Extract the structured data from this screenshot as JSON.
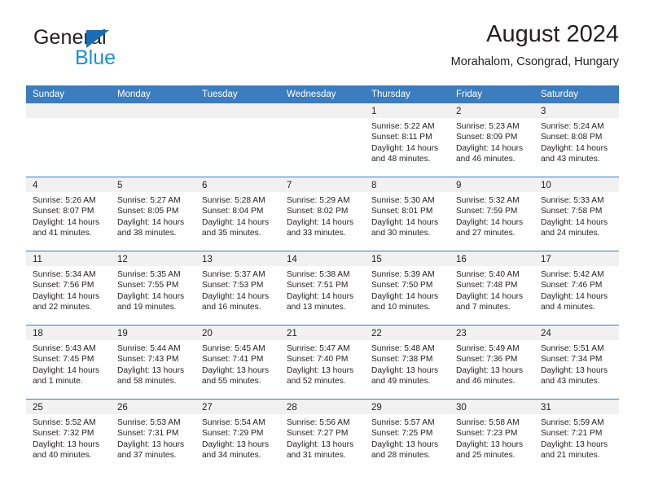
{
  "brand": {
    "word_one": "General",
    "word_two": "Blue",
    "triangle_icon": "triangle-icon",
    "colors": {
      "dark": "#231f20",
      "blue": "#1a8fd8",
      "triangle": "#1a6cb5"
    }
  },
  "header": {
    "title": "August 2024",
    "subtitle": "Morahalom, Csongrad, Hungary"
  },
  "theme": {
    "header_bar": "#3b7dbf",
    "day_number_band": "#f1f1f1",
    "text": "#231f20",
    "cell_background": "#ffffff"
  },
  "weekday_headers": [
    "Sunday",
    "Monday",
    "Tuesday",
    "Wednesday",
    "Thursday",
    "Friday",
    "Saturday"
  ],
  "labels": {
    "sunrise_prefix": "Sunrise:",
    "sunset_prefix": "Sunset:",
    "daylight_prefix": "Daylight:"
  },
  "weeks": [
    [
      {
        "day": "",
        "empty": true,
        "sunrise": "",
        "sunset": "",
        "daylight_line1": "",
        "daylight_line2": ""
      },
      {
        "day": "",
        "empty": true,
        "sunrise": "",
        "sunset": "",
        "daylight_line1": "",
        "daylight_line2": ""
      },
      {
        "day": "",
        "empty": true,
        "sunrise": "",
        "sunset": "",
        "daylight_line1": "",
        "daylight_line2": ""
      },
      {
        "day": "",
        "empty": true,
        "sunrise": "",
        "sunset": "",
        "daylight_line1": "",
        "daylight_line2": ""
      },
      {
        "day": "1",
        "empty": false,
        "sunrise": "Sunrise: 5:22 AM",
        "sunset": "Sunset: 8:11 PM",
        "daylight_line1": "Daylight: 14 hours",
        "daylight_line2": "and 48 minutes."
      },
      {
        "day": "2",
        "empty": false,
        "sunrise": "Sunrise: 5:23 AM",
        "sunset": "Sunset: 8:09 PM",
        "daylight_line1": "Daylight: 14 hours",
        "daylight_line2": "and 46 minutes."
      },
      {
        "day": "3",
        "empty": false,
        "sunrise": "Sunrise: 5:24 AM",
        "sunset": "Sunset: 8:08 PM",
        "daylight_line1": "Daylight: 14 hours",
        "daylight_line2": "and 43 minutes."
      }
    ],
    [
      {
        "day": "4",
        "empty": false,
        "sunrise": "Sunrise: 5:26 AM",
        "sunset": "Sunset: 8:07 PM",
        "daylight_line1": "Daylight: 14 hours",
        "daylight_line2": "and 41 minutes."
      },
      {
        "day": "5",
        "empty": false,
        "sunrise": "Sunrise: 5:27 AM",
        "sunset": "Sunset: 8:05 PM",
        "daylight_line1": "Daylight: 14 hours",
        "daylight_line2": "and 38 minutes."
      },
      {
        "day": "6",
        "empty": false,
        "sunrise": "Sunrise: 5:28 AM",
        "sunset": "Sunset: 8:04 PM",
        "daylight_line1": "Daylight: 14 hours",
        "daylight_line2": "and 35 minutes."
      },
      {
        "day": "7",
        "empty": false,
        "sunrise": "Sunrise: 5:29 AM",
        "sunset": "Sunset: 8:02 PM",
        "daylight_line1": "Daylight: 14 hours",
        "daylight_line2": "and 33 minutes."
      },
      {
        "day": "8",
        "empty": false,
        "sunrise": "Sunrise: 5:30 AM",
        "sunset": "Sunset: 8:01 PM",
        "daylight_line1": "Daylight: 14 hours",
        "daylight_line2": "and 30 minutes."
      },
      {
        "day": "9",
        "empty": false,
        "sunrise": "Sunrise: 5:32 AM",
        "sunset": "Sunset: 7:59 PM",
        "daylight_line1": "Daylight: 14 hours",
        "daylight_line2": "and 27 minutes."
      },
      {
        "day": "10",
        "empty": false,
        "sunrise": "Sunrise: 5:33 AM",
        "sunset": "Sunset: 7:58 PM",
        "daylight_line1": "Daylight: 14 hours",
        "daylight_line2": "and 24 minutes."
      }
    ],
    [
      {
        "day": "11",
        "empty": false,
        "sunrise": "Sunrise: 5:34 AM",
        "sunset": "Sunset: 7:56 PM",
        "daylight_line1": "Daylight: 14 hours",
        "daylight_line2": "and 22 minutes."
      },
      {
        "day": "12",
        "empty": false,
        "sunrise": "Sunrise: 5:35 AM",
        "sunset": "Sunset: 7:55 PM",
        "daylight_line1": "Daylight: 14 hours",
        "daylight_line2": "and 19 minutes."
      },
      {
        "day": "13",
        "empty": false,
        "sunrise": "Sunrise: 5:37 AM",
        "sunset": "Sunset: 7:53 PM",
        "daylight_line1": "Daylight: 14 hours",
        "daylight_line2": "and 16 minutes."
      },
      {
        "day": "14",
        "empty": false,
        "sunrise": "Sunrise: 5:38 AM",
        "sunset": "Sunset: 7:51 PM",
        "daylight_line1": "Daylight: 14 hours",
        "daylight_line2": "and 13 minutes."
      },
      {
        "day": "15",
        "empty": false,
        "sunrise": "Sunrise: 5:39 AM",
        "sunset": "Sunset: 7:50 PM",
        "daylight_line1": "Daylight: 14 hours",
        "daylight_line2": "and 10 minutes."
      },
      {
        "day": "16",
        "empty": false,
        "sunrise": "Sunrise: 5:40 AM",
        "sunset": "Sunset: 7:48 PM",
        "daylight_line1": "Daylight: 14 hours",
        "daylight_line2": "and 7 minutes."
      },
      {
        "day": "17",
        "empty": false,
        "sunrise": "Sunrise: 5:42 AM",
        "sunset": "Sunset: 7:46 PM",
        "daylight_line1": "Daylight: 14 hours",
        "daylight_line2": "and 4 minutes."
      }
    ],
    [
      {
        "day": "18",
        "empty": false,
        "sunrise": "Sunrise: 5:43 AM",
        "sunset": "Sunset: 7:45 PM",
        "daylight_line1": "Daylight: 14 hours",
        "daylight_line2": "and 1 minute."
      },
      {
        "day": "19",
        "empty": false,
        "sunrise": "Sunrise: 5:44 AM",
        "sunset": "Sunset: 7:43 PM",
        "daylight_line1": "Daylight: 13 hours",
        "daylight_line2": "and 58 minutes."
      },
      {
        "day": "20",
        "empty": false,
        "sunrise": "Sunrise: 5:45 AM",
        "sunset": "Sunset: 7:41 PM",
        "daylight_line1": "Daylight: 13 hours",
        "daylight_line2": "and 55 minutes."
      },
      {
        "day": "21",
        "empty": false,
        "sunrise": "Sunrise: 5:47 AM",
        "sunset": "Sunset: 7:40 PM",
        "daylight_line1": "Daylight: 13 hours",
        "daylight_line2": "and 52 minutes."
      },
      {
        "day": "22",
        "empty": false,
        "sunrise": "Sunrise: 5:48 AM",
        "sunset": "Sunset: 7:38 PM",
        "daylight_line1": "Daylight: 13 hours",
        "daylight_line2": "and 49 minutes."
      },
      {
        "day": "23",
        "empty": false,
        "sunrise": "Sunrise: 5:49 AM",
        "sunset": "Sunset: 7:36 PM",
        "daylight_line1": "Daylight: 13 hours",
        "daylight_line2": "and 46 minutes."
      },
      {
        "day": "24",
        "empty": false,
        "sunrise": "Sunrise: 5:51 AM",
        "sunset": "Sunset: 7:34 PM",
        "daylight_line1": "Daylight: 13 hours",
        "daylight_line2": "and 43 minutes."
      }
    ],
    [
      {
        "day": "25",
        "empty": false,
        "sunrise": "Sunrise: 5:52 AM",
        "sunset": "Sunset: 7:32 PM",
        "daylight_line1": "Daylight: 13 hours",
        "daylight_line2": "and 40 minutes."
      },
      {
        "day": "26",
        "empty": false,
        "sunrise": "Sunrise: 5:53 AM",
        "sunset": "Sunset: 7:31 PM",
        "daylight_line1": "Daylight: 13 hours",
        "daylight_line2": "and 37 minutes."
      },
      {
        "day": "27",
        "empty": false,
        "sunrise": "Sunrise: 5:54 AM",
        "sunset": "Sunset: 7:29 PM",
        "daylight_line1": "Daylight: 13 hours",
        "daylight_line2": "and 34 minutes."
      },
      {
        "day": "28",
        "empty": false,
        "sunrise": "Sunrise: 5:56 AM",
        "sunset": "Sunset: 7:27 PM",
        "daylight_line1": "Daylight: 13 hours",
        "daylight_line2": "and 31 minutes."
      },
      {
        "day": "29",
        "empty": false,
        "sunrise": "Sunrise: 5:57 AM",
        "sunset": "Sunset: 7:25 PM",
        "daylight_line1": "Daylight: 13 hours",
        "daylight_line2": "and 28 minutes."
      },
      {
        "day": "30",
        "empty": false,
        "sunrise": "Sunrise: 5:58 AM",
        "sunset": "Sunset: 7:23 PM",
        "daylight_line1": "Daylight: 13 hours",
        "daylight_line2": "and 25 minutes."
      },
      {
        "day": "31",
        "empty": false,
        "sunrise": "Sunrise: 5:59 AM",
        "sunset": "Sunset: 7:21 PM",
        "daylight_line1": "Daylight: 13 hours",
        "daylight_line2": "and 21 minutes."
      }
    ]
  ]
}
